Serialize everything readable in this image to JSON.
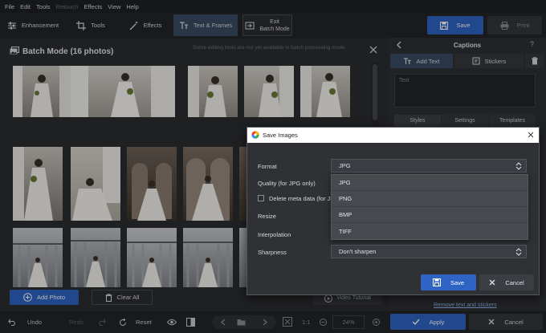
{
  "menu": [
    "File",
    "Edit",
    "Tools",
    "Retouch",
    "Effects",
    "View",
    "Help"
  ],
  "menu_disabled": [
    "Retouch"
  ],
  "toolbar": {
    "enhancement": "Enhancement",
    "tools": "Tools",
    "effects": "Effects",
    "text_frames": "Text & Frames",
    "exit_line1": "Exit",
    "exit_line2": "Batch Mode",
    "save": "Save",
    "print": "Print"
  },
  "batch": {
    "title": "Batch Mode (16 photos)",
    "note": "Some editing tools are not yet available in batch processing mode",
    "add_photo": "Add Photo",
    "clear_all": "Clear All",
    "video_tutorial": "Video Tutorial",
    "photo_count": 16
  },
  "captions": {
    "title": "Captions",
    "help": "?",
    "tab_add_text": "Add Text",
    "tab_stickers": "Stickers",
    "text_placeholder": "Text",
    "style_tabs": [
      "Styles",
      "Settings",
      "Templates"
    ],
    "remove_link": "Remove text and stickers"
  },
  "bottom": {
    "undo": "Undo",
    "redo": "Redo",
    "reset": "Reset",
    "ratio": "1:1",
    "zoom": "24%",
    "apply": "Apply",
    "cancel": "Cancel"
  },
  "dialog": {
    "title": "Save Images",
    "format_label": "Format",
    "format_value": "JPG",
    "quality_label": "Quality (for JPG only)",
    "delete_meta_label": "Delete meta data (for JPG",
    "resize_label": "Resize",
    "interpolation_label": "Interpolation",
    "sharpness_label": "Sharpness",
    "sharpness_value": "Don't sharpen",
    "format_options": [
      "JPG",
      "PNG",
      "BMP",
      "TIFF"
    ],
    "save": "Save",
    "cancel": "Cancel"
  },
  "colors": {
    "accent": "#2f63c4",
    "active_tab": "#3a4c64",
    "link": "#8fb4ea"
  }
}
